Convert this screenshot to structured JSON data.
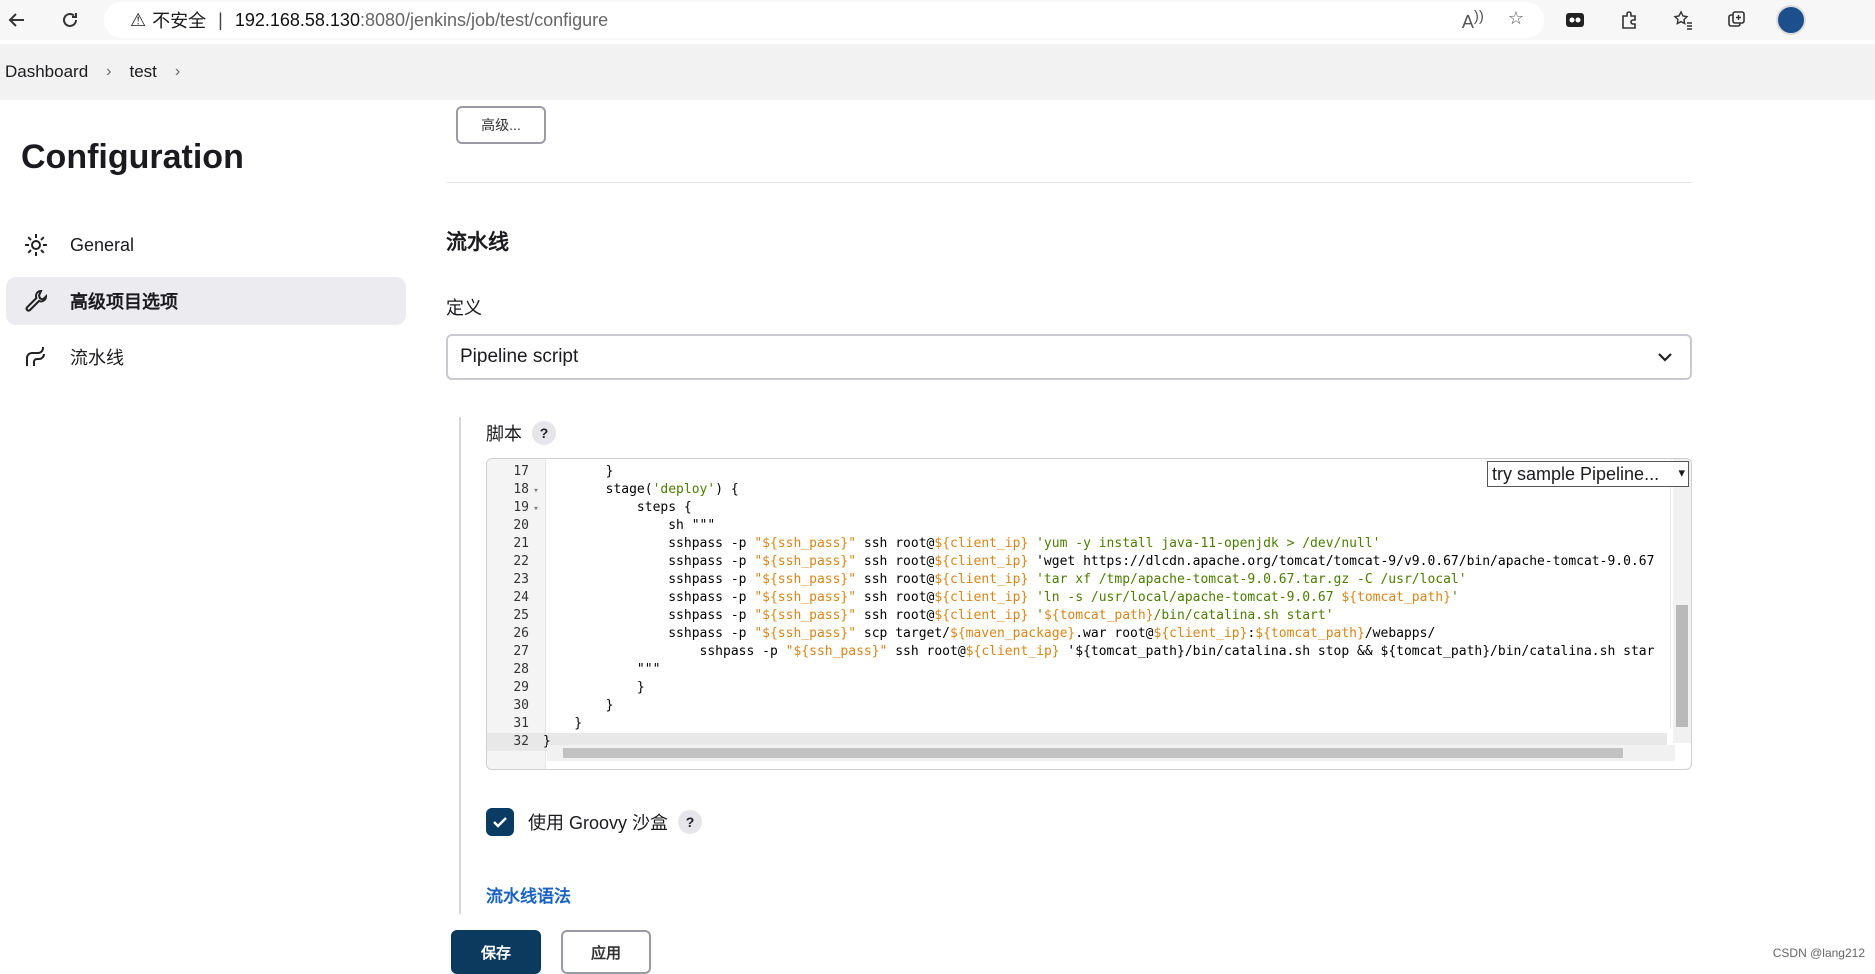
{
  "browser": {
    "security_warning": "不安全",
    "url_host": "192.168.58.130",
    "url_path": ":8080/jenkins/job/test/configure"
  },
  "breadcrumb": [
    "Dashboard",
    "test"
  ],
  "sidebar": {
    "title": "Configuration",
    "items": [
      {
        "label": "General",
        "icon": "gear-icon"
      },
      {
        "label": "高级项目选项",
        "icon": "wrench-icon"
      },
      {
        "label": "流水线",
        "icon": "pipeline-icon"
      }
    ]
  },
  "main": {
    "advanced_button": "高级...",
    "section_title": "流水线",
    "definition_label": "定义",
    "definition_value": "Pipeline script",
    "script_label": "脚本",
    "help_mark": "?",
    "try_sample": "try sample Pipeline...",
    "groovy_sandbox_label": "使用 Groovy 沙盒",
    "groovy_sandbox_checked": true,
    "syntax_link": "流水线语法"
  },
  "editor": {
    "active_line": 32,
    "lines": [
      {
        "n": 17,
        "fold": false,
        "text": "        }"
      },
      {
        "n": 18,
        "fold": true,
        "text": "        stage('deploy') {"
      },
      {
        "n": 19,
        "fold": true,
        "text": "            steps {"
      },
      {
        "n": 20,
        "fold": false,
        "text": "                sh \"\"\""
      },
      {
        "n": 21,
        "fold": false,
        "text": "                sshpass -p \"${ssh_pass}\" ssh root@${client_ip} 'yum -y install java-11-openjdk > /dev/null'"
      },
      {
        "n": 22,
        "fold": false,
        "text": "                sshpass -p \"${ssh_pass}\" ssh root@${client_ip} 'wget https://dlcdn.apache.org/tomcat/tomcat-9/v9.0.67/bin/apache-tomcat-9.0.67"
      },
      {
        "n": 23,
        "fold": false,
        "text": "                sshpass -p \"${ssh_pass}\" ssh root@${client_ip} 'tar xf /tmp/apache-tomcat-9.0.67.tar.gz -C /usr/local'"
      },
      {
        "n": 24,
        "fold": false,
        "text": "                sshpass -p \"${ssh_pass}\" ssh root@${client_ip} 'ln -s /usr/local/apache-tomcat-9.0.67 ${tomcat_path}'"
      },
      {
        "n": 25,
        "fold": false,
        "text": "                sshpass -p \"${ssh_pass}\" ssh root@${client_ip} '${tomcat_path}/bin/catalina.sh start'"
      },
      {
        "n": 26,
        "fold": false,
        "text": "                sshpass -p \"${ssh_pass}\" scp target/${maven_package}.war root@${client_ip}:${tomcat_path}/webapps/"
      },
      {
        "n": 27,
        "fold": false,
        "text": "                    sshpass -p \"${ssh_pass}\" ssh root@${client_ip} '${tomcat_path}/bin/catalina.sh stop && ${tomcat_path}/bin/catalina.sh star"
      },
      {
        "n": 28,
        "fold": false,
        "text": "            \"\"\""
      },
      {
        "n": 29,
        "fold": false,
        "text": "            }"
      },
      {
        "n": 30,
        "fold": false,
        "text": "        }"
      },
      {
        "n": 31,
        "fold": false,
        "text": "    }"
      },
      {
        "n": 32,
        "fold": false,
        "text": "}"
      }
    ]
  },
  "actions": {
    "save": "保存",
    "apply": "应用"
  },
  "watermark": "CSDN @lang212"
}
